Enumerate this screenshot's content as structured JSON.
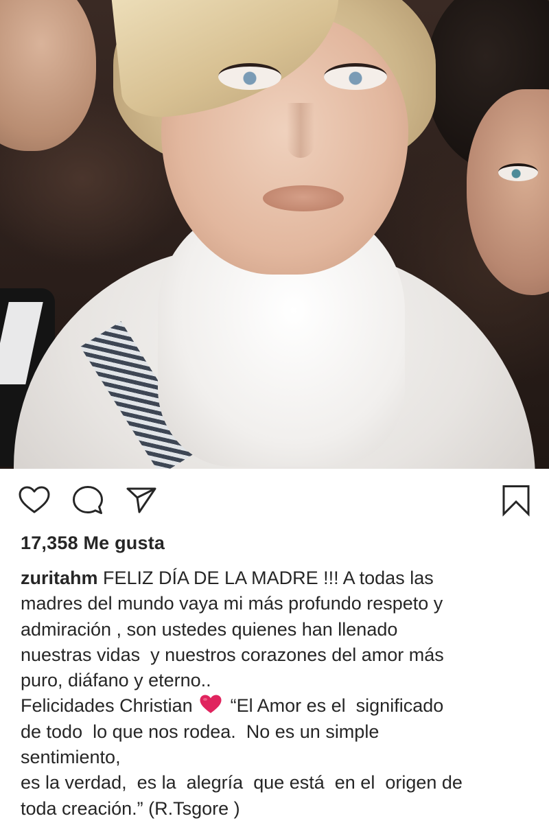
{
  "post": {
    "image": {
      "alt": "",
      "icon": "photo-portrait"
    },
    "actions": {
      "like_icon": "heart-outline-icon",
      "comment_icon": "comment-bubble-icon",
      "share_icon": "paper-plane-icon",
      "save_icon": "bookmark-outline-icon"
    },
    "likes": {
      "label": "17,358 Me gusta"
    },
    "caption": {
      "username": "zuritahm",
      "line1_rest": " FELIZ DÍA DE LA MADRE !!! A todas las",
      "line2": "madres del mundo vaya mi más profundo respeto y",
      "line3": "admiración , son ustedes quienes han llenado",
      "line4": "nuestras vidas  y nuestros corazones del amor más",
      "line5": "puro, diáfano y eterno..",
      "line6_start": "Felicidades Christian ",
      "heart_emoji": "red-heart-emoji",
      "line6_end": " “El Amor es el  significado",
      "line7": "de todo  lo que nos rodea.  No es un simple",
      "line8": "sentimiento,",
      "line9": "es la verdad,  es la  alegría  que está  en el  origen de",
      "line10": "toda creación.” (R.Tsgore )"
    },
    "colors": {
      "text": "#262626",
      "background": "#ffffff",
      "heart_emoji": "#e0245e"
    }
  }
}
